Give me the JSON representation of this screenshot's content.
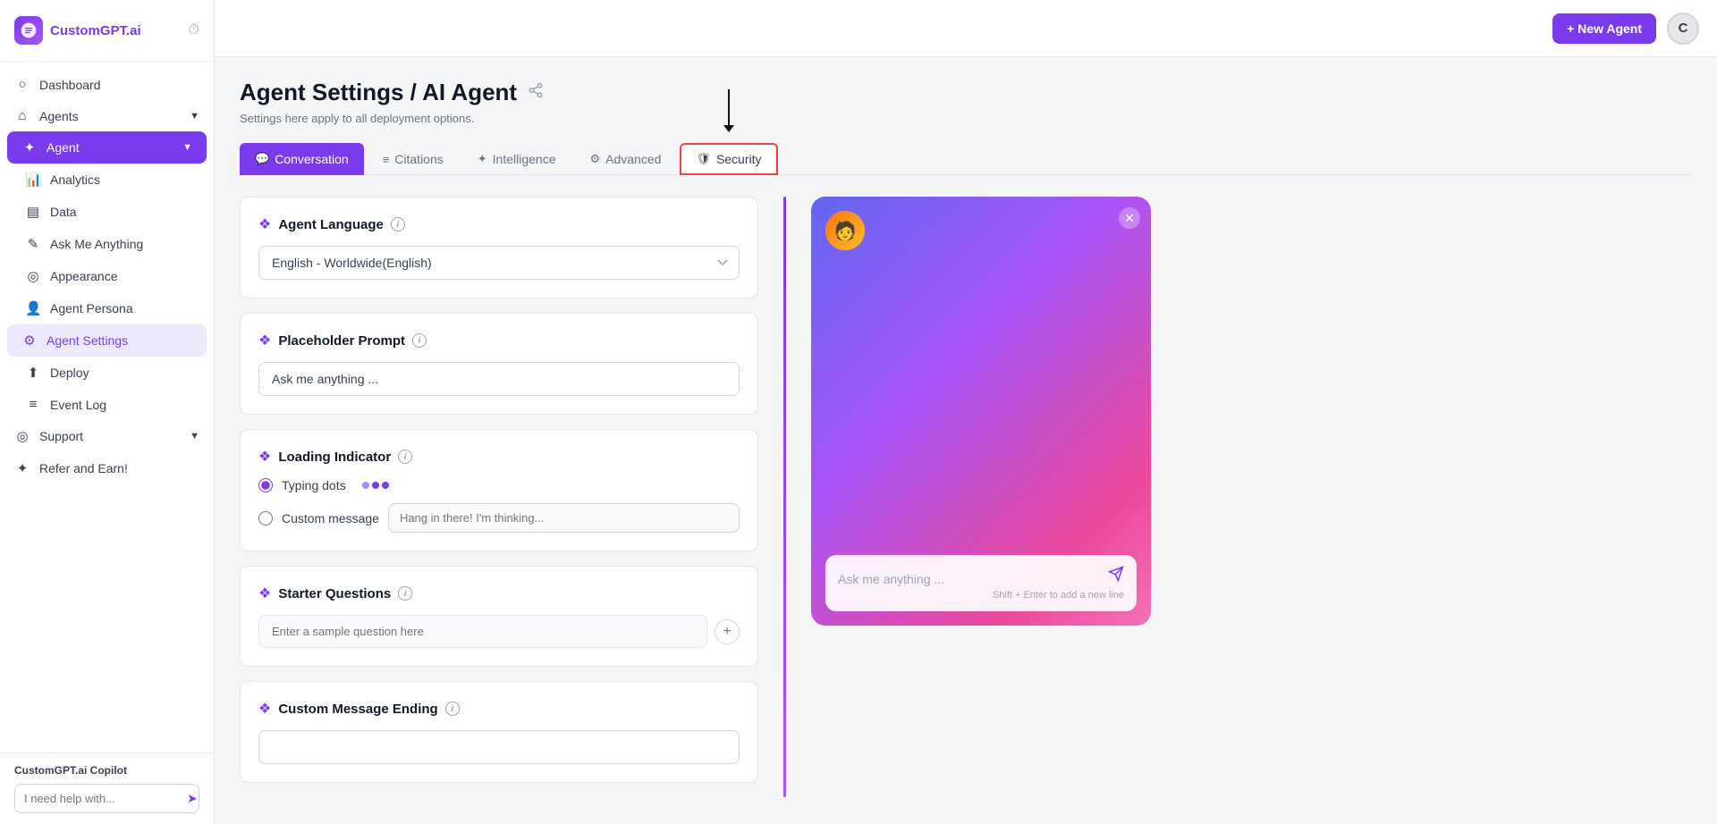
{
  "app": {
    "name": "CustomGPT.ai",
    "logo_letter": "C"
  },
  "sidebar": {
    "nav_items": [
      {
        "id": "dashboard",
        "label": "Dashboard",
        "icon": "○",
        "active": false
      },
      {
        "id": "agents",
        "label": "Agents",
        "icon": "⌂",
        "active": false,
        "has_chevron": true
      },
      {
        "id": "agent",
        "label": "Agent",
        "icon": "☆",
        "active": true,
        "has_chevron": true
      },
      {
        "id": "analytics",
        "label": "Analytics",
        "icon": "📊",
        "active": false,
        "indent": true
      },
      {
        "id": "data",
        "label": "Data",
        "icon": "▤",
        "active": false,
        "indent": true
      },
      {
        "id": "ask-me-anything",
        "label": "Ask Me Anything",
        "icon": "✎",
        "active": false,
        "indent": true
      },
      {
        "id": "appearance",
        "label": "Appearance",
        "icon": "◎",
        "active": false,
        "indent": true
      },
      {
        "id": "agent-persona",
        "label": "Agent Persona",
        "icon": "👤",
        "active": false,
        "indent": true
      },
      {
        "id": "agent-settings",
        "label": "Agent Settings",
        "icon": "⚙",
        "active": false,
        "indent": true,
        "active_sub": true
      },
      {
        "id": "deploy",
        "label": "Deploy",
        "icon": "⬆",
        "active": false,
        "indent": true
      },
      {
        "id": "event-log",
        "label": "Event Log",
        "icon": "≡",
        "active": false,
        "indent": true
      },
      {
        "id": "support",
        "label": "Support",
        "icon": "◎",
        "active": false,
        "has_chevron": true
      },
      {
        "id": "refer-earn",
        "label": "Refer and Earn!",
        "icon": "✦",
        "active": false
      }
    ],
    "copilot": {
      "label": "CustomGPT.ai Copilot",
      "placeholder": "I need help with..."
    }
  },
  "topbar": {
    "new_agent_label": "+ New Agent",
    "user_initial": "C"
  },
  "page": {
    "title": "Agent Settings / AI Agent",
    "subtitle": "Settings here apply to all deployment options."
  },
  "tabs": [
    {
      "id": "conversation",
      "label": "Conversation",
      "icon": "💬",
      "active": true
    },
    {
      "id": "citations",
      "label": "Citations",
      "icon": "≡",
      "active": false
    },
    {
      "id": "intelligence",
      "label": "Intelligence",
      "icon": "✦",
      "active": false
    },
    {
      "id": "advanced",
      "label": "Advanced",
      "icon": "⚙",
      "active": false
    },
    {
      "id": "security",
      "label": "Security",
      "icon": "🛡",
      "active": false,
      "highlighted": true
    }
  ],
  "form": {
    "agent_language": {
      "title": "Agent Language",
      "value": "English - Worldwide(English)"
    },
    "placeholder_prompt": {
      "title": "Placeholder Prompt",
      "value": "Ask me anything ..."
    },
    "loading_indicator": {
      "title": "Loading Indicator",
      "options": [
        {
          "id": "typing-dots",
          "label": "Typing dots",
          "selected": true
        },
        {
          "id": "custom-message",
          "label": "Custom message",
          "selected": false
        }
      ],
      "custom_placeholder": "Hang in there! I'm thinking..."
    },
    "starter_questions": {
      "title": "Starter Questions",
      "placeholder": "Enter a sample question here"
    },
    "custom_message_ending": {
      "title": "Custom Message Ending"
    }
  },
  "preview": {
    "chat_placeholder": "Ask me anything ...",
    "hint": "Shift + Enter to add a new line",
    "close_icon": "✕"
  }
}
